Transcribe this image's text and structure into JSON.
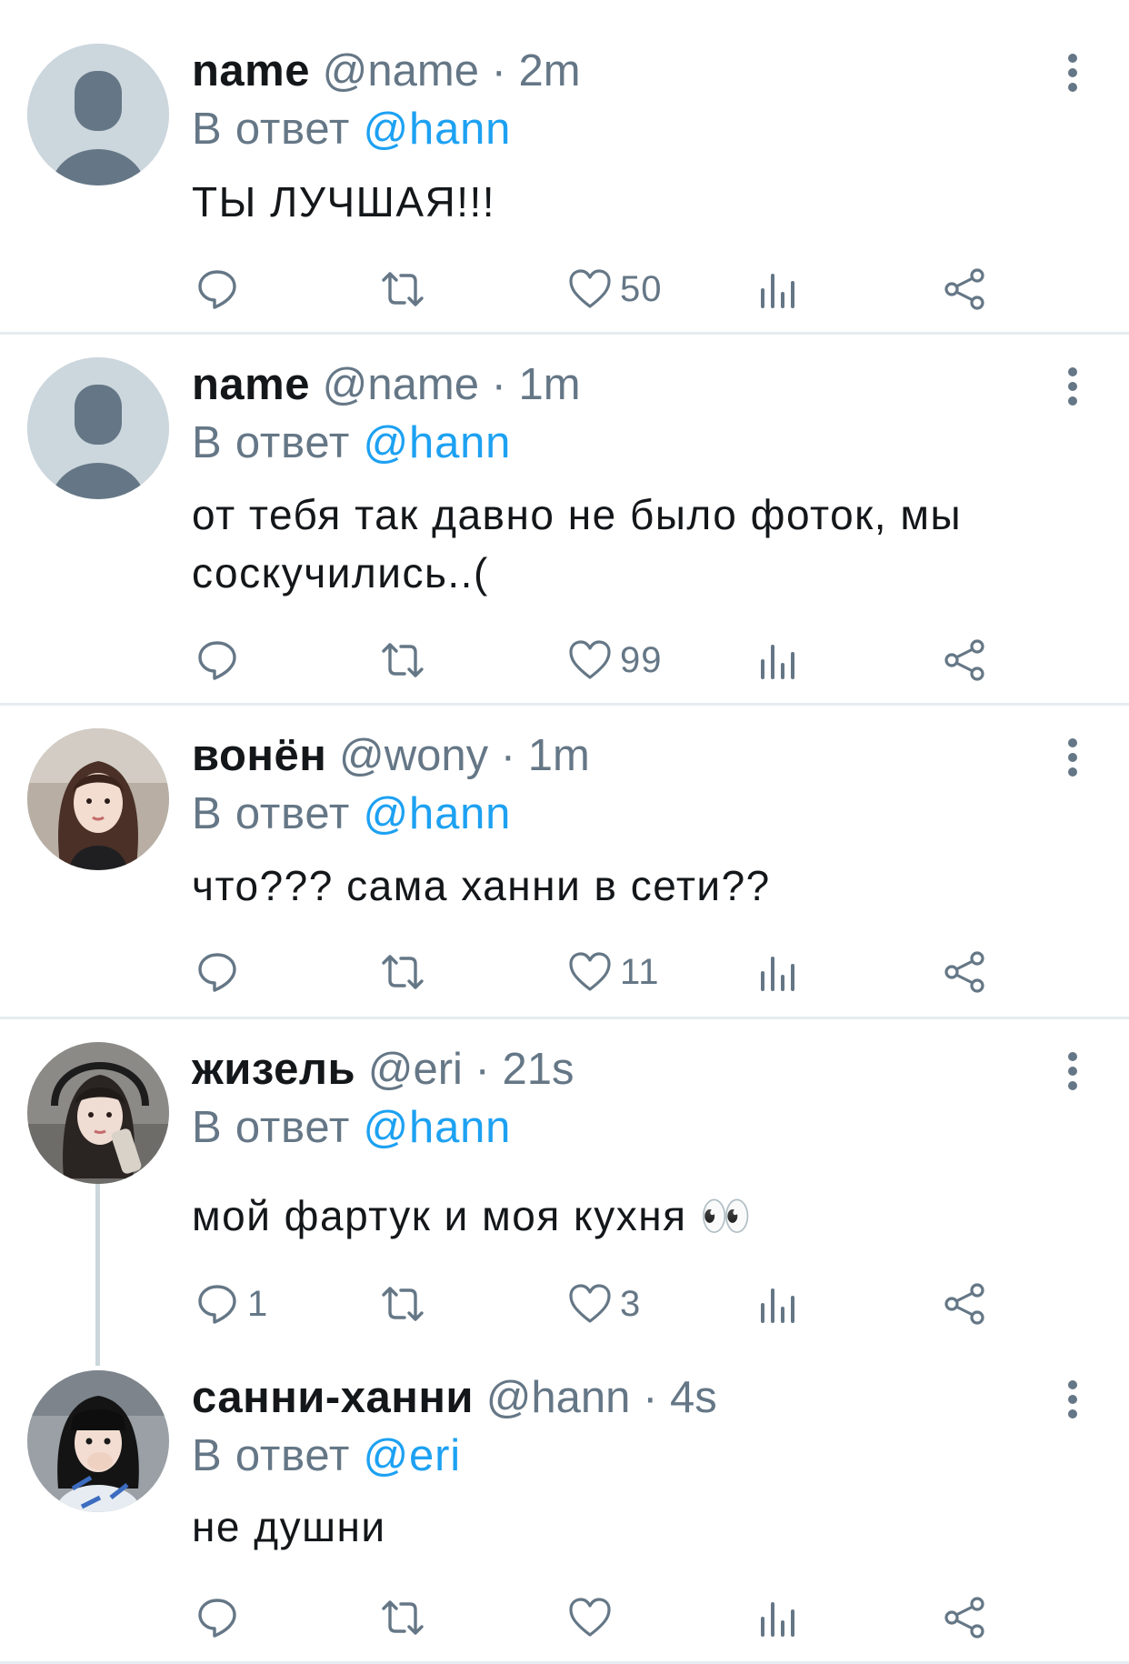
{
  "tweets": [
    {
      "name": "name",
      "handle": "@name",
      "dot": "·",
      "time": "2m",
      "reply_prefix": "В ответ",
      "reply_to": "@hann",
      "text": "ТЫ ЛУЧШАЯ!!!",
      "counts": {
        "reply": "",
        "retweet": "",
        "like": "50"
      }
    },
    {
      "name": "name",
      "handle": "@name",
      "dot": "·",
      "time": "1m",
      "reply_prefix": "В ответ",
      "reply_to": "@hann",
      "text": "от тебя так давно не было фоток, мы соскучились..(",
      "counts": {
        "reply": "",
        "retweet": "",
        "like": "99"
      }
    },
    {
      "name": "вонён",
      "handle": "@wony",
      "dot": "·",
      "time": "1m",
      "reply_prefix": "В ответ",
      "reply_to": "@hann",
      "text": "что??? сама ханни в сети??",
      "counts": {
        "reply": "",
        "retweet": "",
        "like": "11"
      }
    },
    {
      "name": "жизель",
      "handle": "@eri",
      "dot": "·",
      "time": "21s",
      "reply_prefix": "В ответ",
      "reply_to": "@hann",
      "text": "мой фартук и моя кухня 👀",
      "counts": {
        "reply": "1",
        "retweet": "",
        "like": "3"
      }
    },
    {
      "name": "санни-ханни",
      "handle": "@hann",
      "dot": "·",
      "time": "4s",
      "reply_prefix": "В ответ",
      "reply_to": "@eri",
      "text": "не душни",
      "counts": {
        "reply": "",
        "retweet": "",
        "like": ""
      }
    }
  ],
  "icons": {
    "reply": "reply-icon",
    "retweet": "retweet-icon",
    "like": "heart-icon",
    "views": "views-icon",
    "share": "share-icon",
    "more": "more-vertical-icon"
  },
  "colors": {
    "accent": "#1da1f2",
    "muted": "#657786",
    "text": "#14171a",
    "divider": "#e6ecf0"
  }
}
